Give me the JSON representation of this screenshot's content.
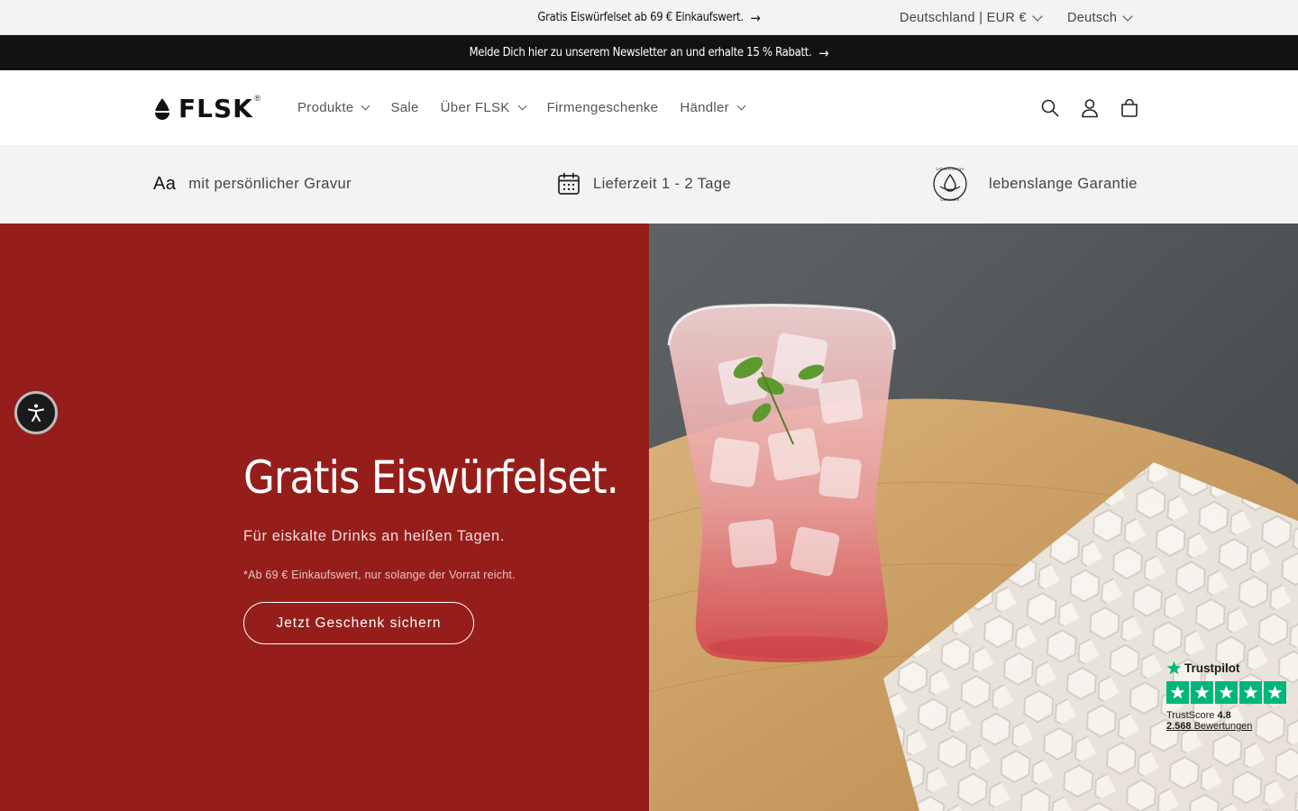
{
  "announcement": {
    "message": "Gratis Eiswürfelset ab 69 € Einkaufswert.",
    "arrow": "→",
    "country": "Deutschland | EUR €",
    "language": "Deutsch"
  },
  "newsletter": {
    "message": "Melde Dich hier zu unserem Newsletter an und erhalte 15 % Rabatt.",
    "arrow": "→"
  },
  "header": {
    "logo_text": "FLSK",
    "logo_reg": "®",
    "nav": [
      {
        "label": "Produkte",
        "dropdown": true
      },
      {
        "label": "Sale",
        "dropdown": false
      },
      {
        "label": "Über FLSK",
        "dropdown": true
      },
      {
        "label": "Firmengeschenke",
        "dropdown": false
      },
      {
        "label": "Händler",
        "dropdown": true
      }
    ],
    "icons": [
      "search-icon",
      "account-icon",
      "cart-icon"
    ]
  },
  "usp": {
    "engraving_icon_text": "Aa",
    "engraving": "mit persönlicher Gravur",
    "delivery": "Lieferzeit 1 - 2 Tage",
    "guarantee": "lebenslange Garantie",
    "guarantee_badge_top": "Lebenslange",
    "guarantee_badge_bottom": "Garantie"
  },
  "hero": {
    "title": "Gratis Eiswürfelset.",
    "subtitle": "Für eiskalte Drinks an heißen Tagen.",
    "note": "*Ab 69 € Einkaufswert, nur solange der Vorrat reicht.",
    "button": "Jetzt Geschenk sichern",
    "bg_color": "#951e1b"
  },
  "trustpilot": {
    "brand": "Trustpilot",
    "score_label": "TrustScore",
    "score": "4.8",
    "reviews_count": "2.568",
    "reviews_label": "Bewertungen",
    "star_color": "#00b67a"
  }
}
